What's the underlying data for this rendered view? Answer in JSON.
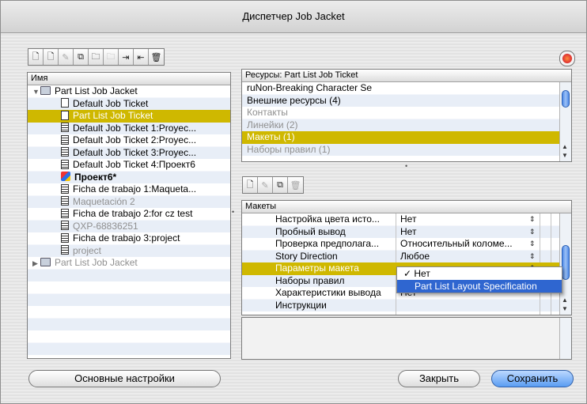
{
  "window": {
    "title": "Диспетчер Job Jacket"
  },
  "toolbar_left": {
    "icons": [
      "new-job-jacket-icon",
      "new-job-ticket-icon",
      "edit-icon",
      "duplicate-icon",
      "open-folder-icon",
      "move-icon",
      "import-icon",
      "export-icon",
      "delete-icon"
    ],
    "glyphs": [
      "🗋",
      "🗋",
      "✎",
      "⧉",
      "🗀",
      "🗀",
      "⇥",
      "⇤",
      "🗑"
    ]
  },
  "toolbar_mid": {
    "icons": [
      "new-icon",
      "edit-icon",
      "duplicate-icon",
      "delete-icon"
    ],
    "glyphs": [
      "🗋",
      "✎",
      "⧉",
      "🗑"
    ]
  },
  "left_tree": {
    "header": "Имя",
    "rows": [
      {
        "label": "Part List Job Jacket",
        "indent": 0,
        "icon": "folder",
        "expanded": true
      },
      {
        "label": "Default Job Ticket",
        "indent": 1,
        "icon": "doc"
      },
      {
        "label": "Part List Job Ticket",
        "indent": 1,
        "icon": "doc",
        "selected": true
      },
      {
        "label": "Default Job Ticket 1:Proyec...",
        "indent": 1,
        "icon": "lines"
      },
      {
        "label": "Default Job Ticket 2:Proyec...",
        "indent": 1,
        "icon": "lines"
      },
      {
        "label": "Default Job Ticket 3:Proyec...",
        "indent": 1,
        "icon": "lines"
      },
      {
        "label": "Default Job Ticket 4:Проект6",
        "indent": 1,
        "icon": "lines"
      },
      {
        "label": "Проект6*",
        "indent": 1,
        "icon": "proj",
        "bold": true
      },
      {
        "label": "Ficha de trabajo 1:Maqueta...",
        "indent": 1,
        "icon": "lines"
      },
      {
        "label": "Maquetación 2",
        "indent": 1,
        "icon": "lines",
        "grey": true
      },
      {
        "label": "Ficha de trabajo 2:for cz test",
        "indent": 1,
        "icon": "lines"
      },
      {
        "label": "QXP-68836251",
        "indent": 1,
        "icon": "lines",
        "grey": true
      },
      {
        "label": "Ficha de trabajo 3:project",
        "indent": 1,
        "icon": "lines"
      },
      {
        "label": "project",
        "indent": 1,
        "icon": "lines",
        "grey": true
      },
      {
        "label": "Part List Job Jacket",
        "indent": 0,
        "icon": "folder",
        "grey": true,
        "collapsed": true
      }
    ]
  },
  "resources": {
    "header": "Ресурсы: Part List Job Ticket",
    "rows": [
      {
        "label": "ruNon-Breaking Character Se",
        "bold": false
      },
      {
        "label": "Внешние ресурсы (4)",
        "bold": false
      },
      {
        "label": "Контакты",
        "grey": true
      },
      {
        "label": "Линейки (2)",
        "grey": true
      },
      {
        "label": "Макеты (1)",
        "selected": true
      },
      {
        "label": "Наборы правил (1)",
        "grey": true
      }
    ]
  },
  "layouts": {
    "header": "Макеты",
    "rows": [
      {
        "label": "Настройка цвета исто...",
        "value": "Нет"
      },
      {
        "label": "Пробный вывод",
        "value": "Нет"
      },
      {
        "label": "Проверка предполага...",
        "value": "Относительный коломе..."
      },
      {
        "label": "Story Direction",
        "value": "Любое"
      },
      {
        "label": "Параметры макета",
        "value": "",
        "selected": true
      },
      {
        "label": "Наборы правил",
        "value": ""
      },
      {
        "label": "Характеристики вывода",
        "value": "Нет"
      },
      {
        "label": "Инструкции",
        "value": ""
      }
    ]
  },
  "popup": {
    "items": [
      {
        "label": "✓  Нет",
        "highlighted": false
      },
      {
        "label": "Part List Layout Specification",
        "highlighted": true
      }
    ]
  },
  "buttons": {
    "basic_settings": "Основные настройки",
    "close": "Закрыть",
    "save": "Сохранить"
  }
}
